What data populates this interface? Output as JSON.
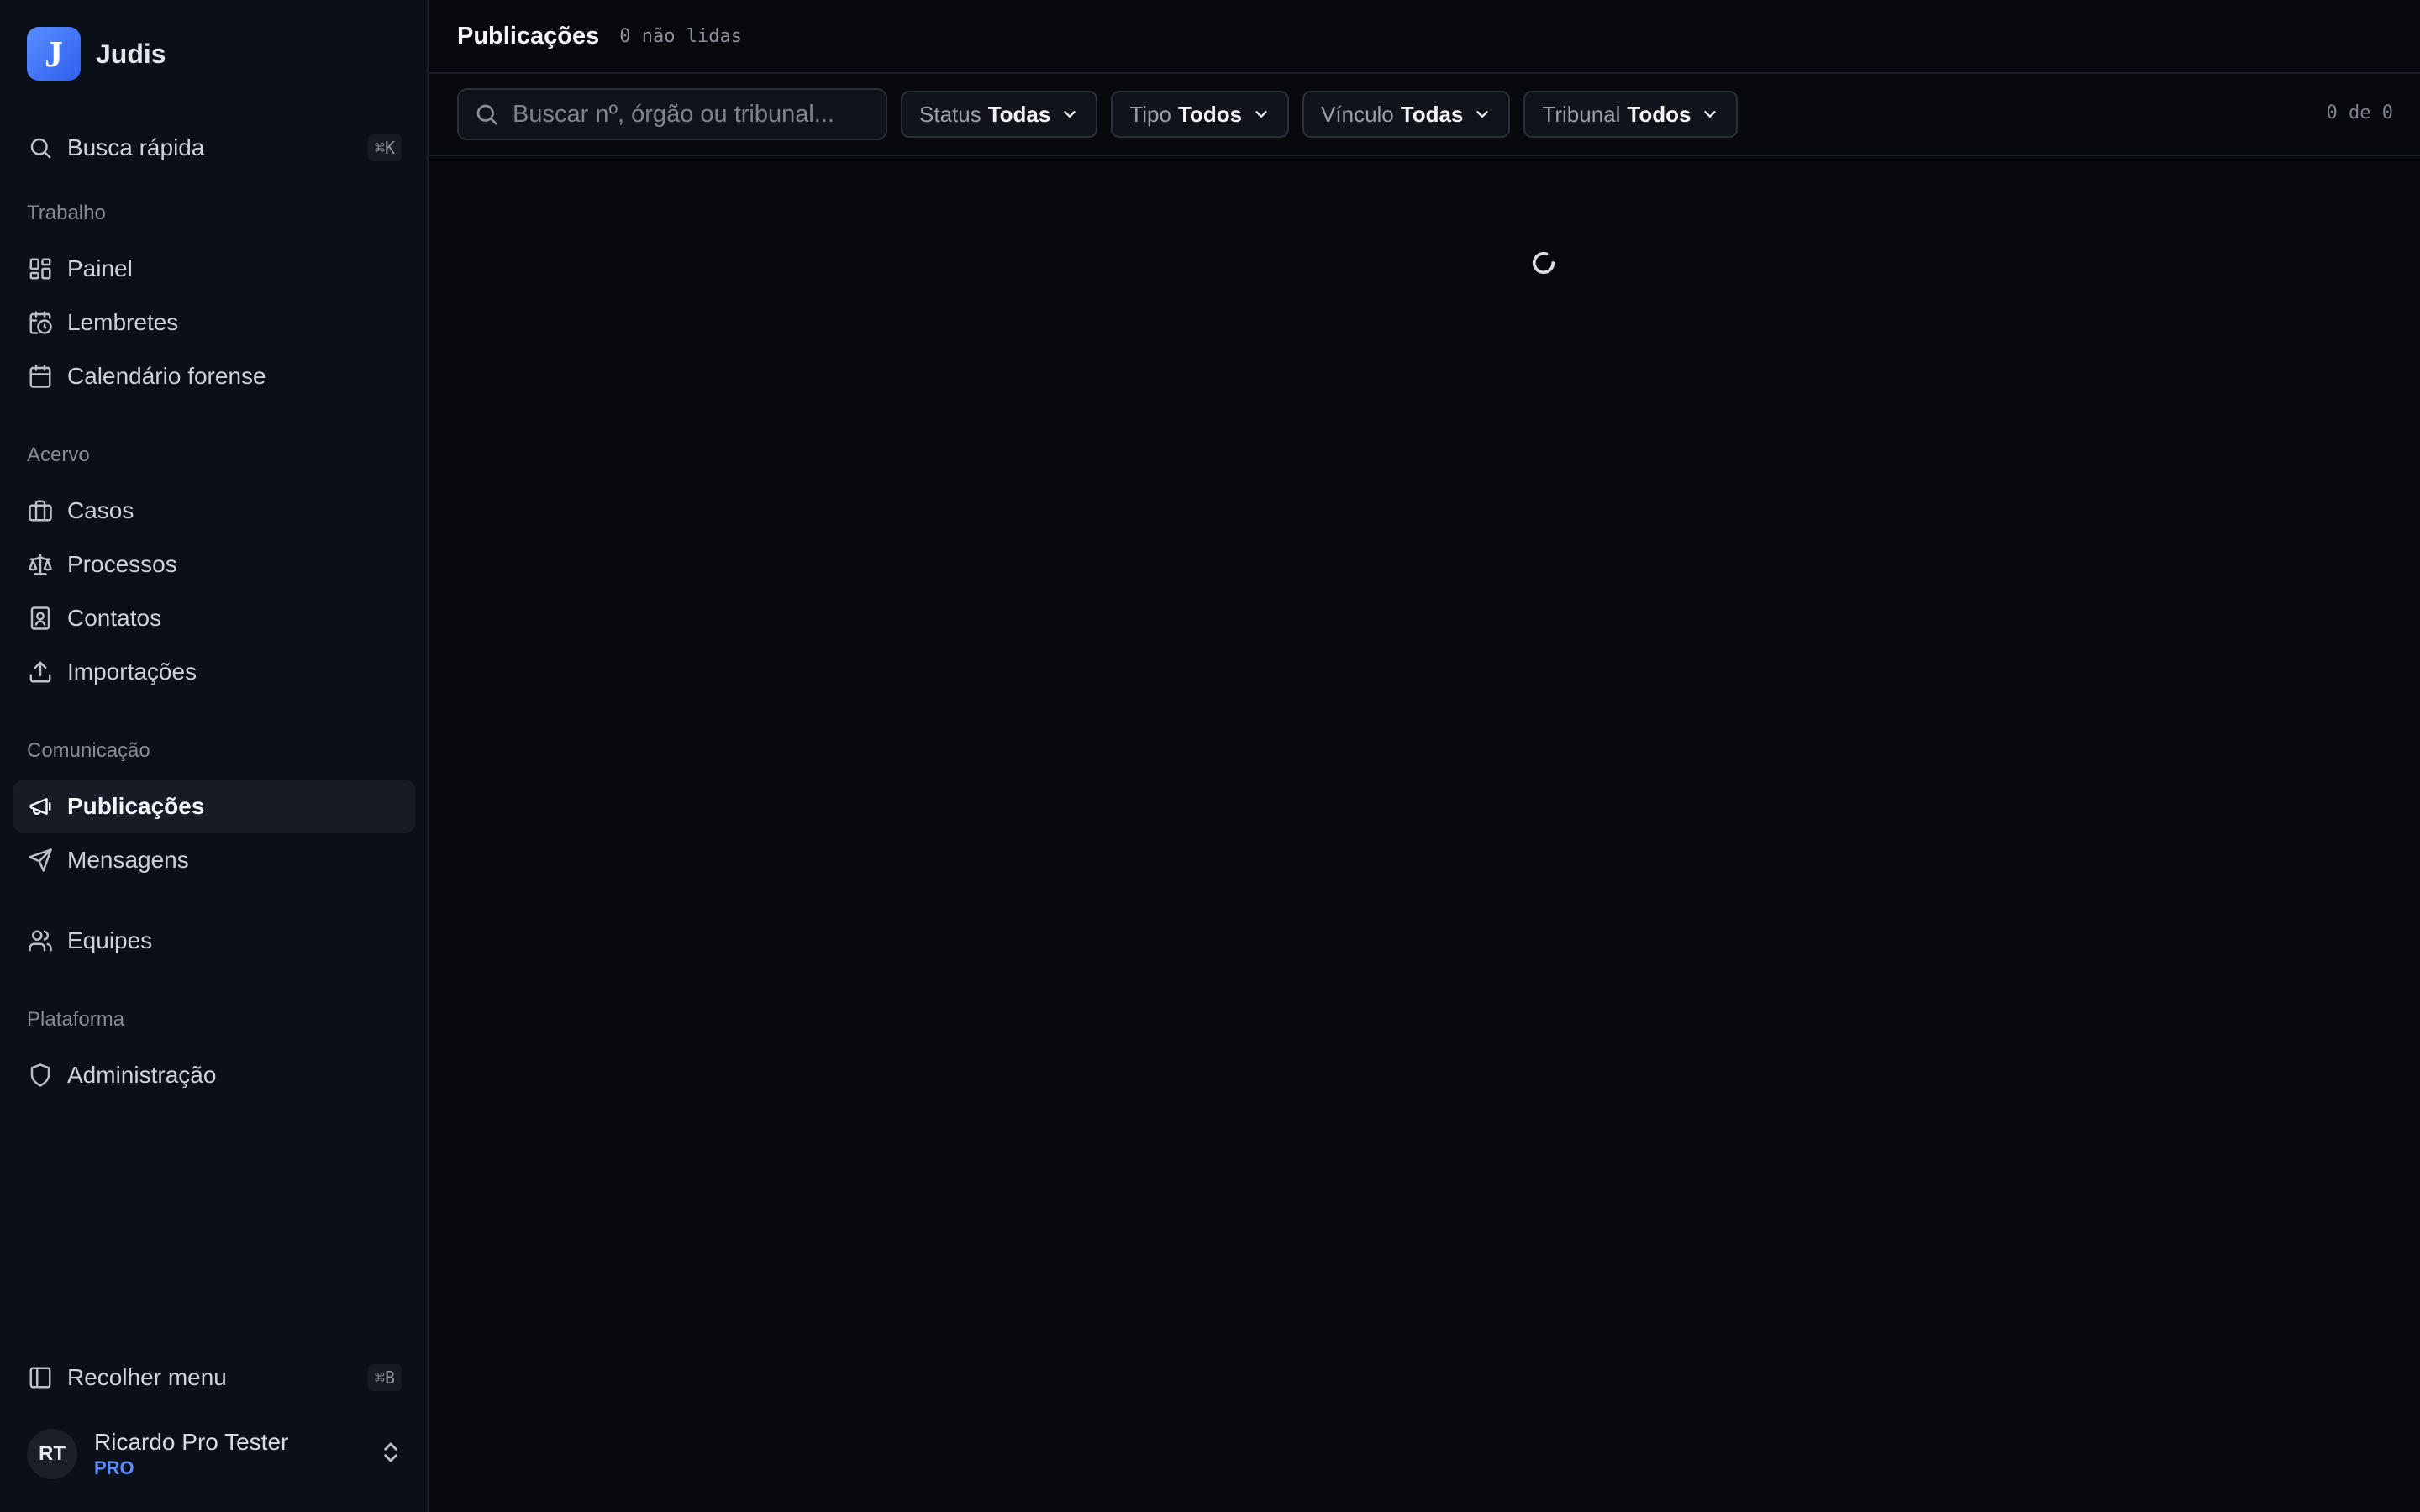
{
  "brand": {
    "logo_letter": "J",
    "name": "Judis"
  },
  "quick_search": {
    "label": "Busca rápida",
    "shortcut": "⌘K"
  },
  "sections": {
    "work": "Trabalho",
    "collection": "Acervo",
    "communication": "Comunicação",
    "platform": "Plataforma"
  },
  "nav": {
    "painel": "Painel",
    "lembretes": "Lembretes",
    "calendario": "Calendário forense",
    "casos": "Casos",
    "processos": "Processos",
    "contatos": "Contatos",
    "importacoes": "Importações",
    "publicacoes": "Publicações",
    "mensagens": "Mensagens",
    "equipes": "Equipes",
    "administracao": "Administração"
  },
  "collapse": {
    "label": "Recolher menu",
    "shortcut": "⌘B"
  },
  "user": {
    "initials": "RT",
    "name": "Ricardo Pro Tester",
    "plan": "PRO"
  },
  "header": {
    "title": "Publicações",
    "unread": "0 não lidas"
  },
  "search": {
    "placeholder": "Buscar nº, órgão ou tribunal..."
  },
  "filters": [
    {
      "label": "Status",
      "value": "Todas"
    },
    {
      "label": "Tipo",
      "value": "Todos"
    },
    {
      "label": "Vínculo",
      "value": "Todas"
    },
    {
      "label": "Tribunal",
      "value": "Todos"
    }
  ],
  "count": "0 de 0",
  "colors": {
    "accent": "#5b8dff",
    "background": "#08090d",
    "sidebar": "#0b0f18"
  }
}
